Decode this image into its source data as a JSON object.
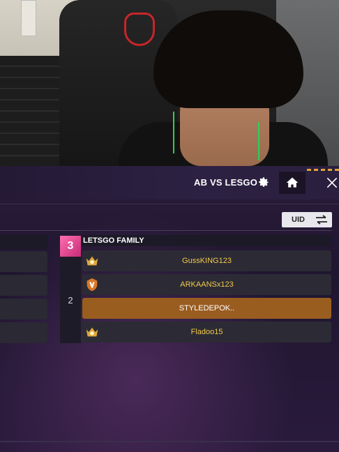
{
  "match": {
    "title": "AB VS LESGO"
  },
  "uid_toggle": {
    "label": "UID"
  },
  "team": {
    "logo_text": "3",
    "name": "LETSGO FAMILY",
    "rank": "2",
    "players": [
      {
        "name": "GussKING123",
        "badge": "crown-badge-icon",
        "selected": false
      },
      {
        "name": "ARKAANSx123",
        "badge": "v-badge-icon",
        "selected": false
      },
      {
        "name": "STYLEDEPOK..",
        "badge": "",
        "selected": true
      },
      {
        "name": "Fladoo15",
        "badge": "crown-badge-icon",
        "selected": false
      }
    ]
  },
  "colors": {
    "highlight_row": "#9a5d20",
    "player_name": "#f2c94c",
    "team_logo": "#c72a78"
  }
}
